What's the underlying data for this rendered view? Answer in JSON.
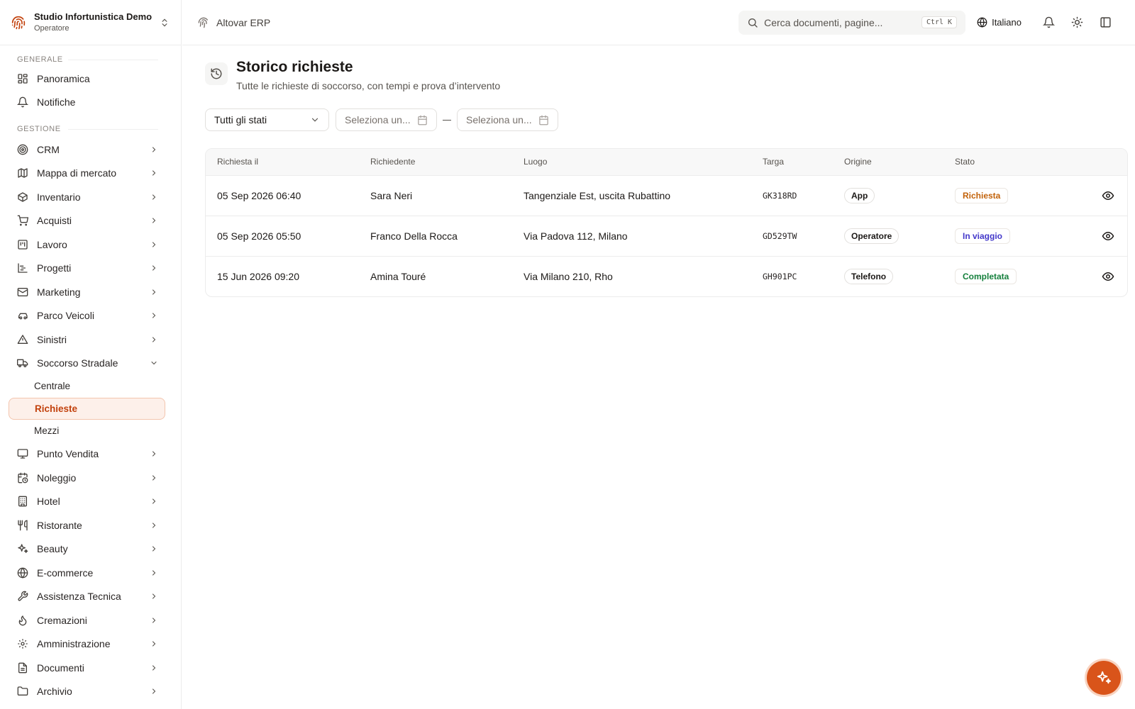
{
  "org": {
    "name": "Studio Infortunistica Demo",
    "role": "Operatore"
  },
  "topbar": {
    "brand": "Altovar ERP",
    "search_placeholder": "Cerca documenti, pagine...",
    "shortcut": "Ctrl K",
    "language": "Italiano"
  },
  "sidebar": {
    "section_general": "GENERALE",
    "section_management": "GESTIONE",
    "general": [
      {
        "label": "Panoramica",
        "icon": "dashboard-icon"
      },
      {
        "label": "Notifiche",
        "icon": "bell-icon"
      }
    ],
    "items": [
      {
        "label": "CRM",
        "icon": "target-icon"
      },
      {
        "label": "Mappa di mercato",
        "icon": "map-icon"
      },
      {
        "label": "Inventario",
        "icon": "box-icon"
      },
      {
        "label": "Acquisti",
        "icon": "cart-icon"
      },
      {
        "label": "Lavoro",
        "icon": "kanban-icon"
      },
      {
        "label": "Progetti",
        "icon": "gantt-icon"
      },
      {
        "label": "Marketing",
        "icon": "mail-icon"
      },
      {
        "label": "Parco Veicoli",
        "icon": "car-icon"
      },
      {
        "label": "Sinistri",
        "icon": "alert-triangle-icon"
      },
      {
        "label": "Soccorso Stradale",
        "icon": "truck-icon"
      }
    ],
    "soccorso_sub": [
      {
        "label": "Centrale"
      },
      {
        "label": "Richieste"
      },
      {
        "label": "Mezzi"
      }
    ],
    "items_after": [
      {
        "label": "Punto Vendita",
        "icon": "monitor-icon"
      },
      {
        "label": "Noleggio",
        "icon": "calendar-clock-icon"
      },
      {
        "label": "Hotel",
        "icon": "building-icon"
      },
      {
        "label": "Ristorante",
        "icon": "utensils-icon"
      },
      {
        "label": "Beauty",
        "icon": "sparkles-icon"
      },
      {
        "label": "E-commerce",
        "icon": "globe-icon"
      },
      {
        "label": "Assistenza Tecnica",
        "icon": "wrench-icon"
      },
      {
        "label": "Cremazioni",
        "icon": "flame-icon"
      },
      {
        "label": "Amministrazione",
        "icon": "gear-icon"
      },
      {
        "label": "Documenti",
        "icon": "file-icon"
      },
      {
        "label": "Archivio",
        "icon": "folder-icon"
      }
    ]
  },
  "page": {
    "title": "Storico richieste",
    "subtitle": "Tutte le richieste di soccorso, con tempi e prova d’intervento"
  },
  "filters": {
    "status": "Tutti gli stati",
    "date_from_placeholder": "Seleziona un...",
    "date_to_placeholder": "Seleziona un..."
  },
  "table": {
    "columns": [
      "Richiesta il",
      "Richiedente",
      "Luogo",
      "Targa",
      "Origine",
      "Stato"
    ],
    "rows": [
      {
        "date": "05 Sep 2026 06:40",
        "requester": "Sara Neri",
        "place": "Tangenziale Est, uscita Rubattino",
        "plate": "GK318RD",
        "origin": "App",
        "status": "Richiesta",
        "status_color": "#c2620a"
      },
      {
        "date": "05 Sep 2026 05:50",
        "requester": "Franco Della Rocca",
        "place": "Via Padova 112, Milano",
        "plate": "GD529TW",
        "origin": "Operatore",
        "status": "In viaggio",
        "status_color": "#4338ca"
      },
      {
        "date": "15 Jun 2026 09:20",
        "requester": "Amina Touré",
        "place": "Via Milano 210, Rho",
        "plate": "GH901PC",
        "origin": "Telefono",
        "status": "Completata",
        "status_color": "#15803d"
      }
    ]
  },
  "colors": {
    "accent": "#d9541a",
    "active_bg": "#fdf0ea"
  }
}
